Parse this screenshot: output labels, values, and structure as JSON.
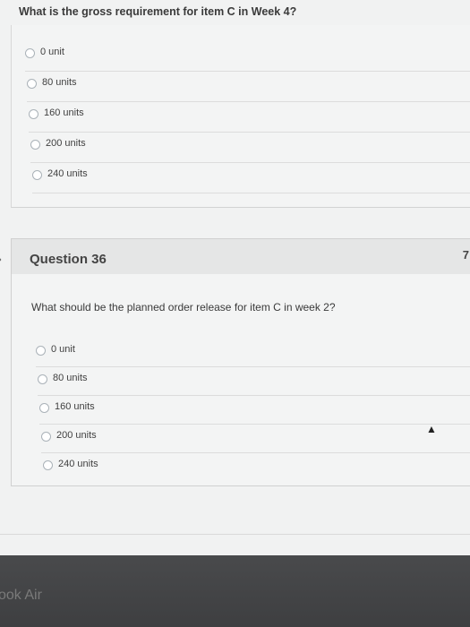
{
  "question1": {
    "text": "What is the gross requirement for item C in Week 4?",
    "options": [
      "0 unit",
      "80 units",
      "160 units",
      "200 units",
      "240 units"
    ]
  },
  "question2": {
    "number": "Question 36",
    "points": "7",
    "text": "What should be the planned order release for item C in week 2?",
    "options": [
      "0 unit",
      "80 units",
      "160 units",
      "200 units",
      "240 units"
    ]
  },
  "device": {
    "label": "ook Air"
  }
}
